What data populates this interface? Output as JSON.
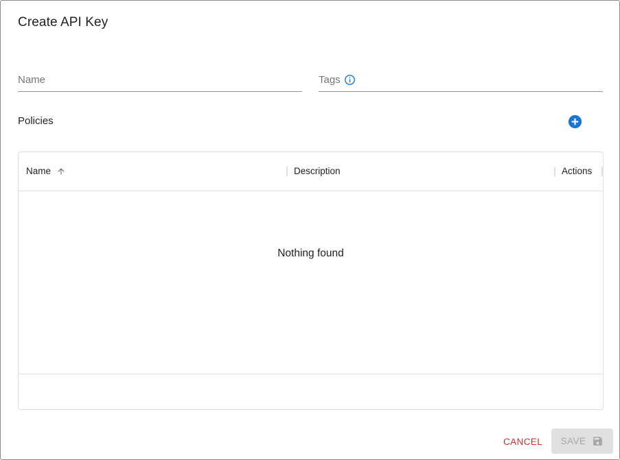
{
  "dialog": {
    "title": "Create API Key"
  },
  "form": {
    "name_label": "Name",
    "name_value": "",
    "tags_label": "Tags",
    "tags_value": "",
    "tags_info_icon": "info-circle-outline-icon"
  },
  "policies": {
    "label": "Policies",
    "add_icon": "add-circle-icon",
    "table": {
      "columns": [
        {
          "label": "Name",
          "sort": "ascending",
          "sort_icon": "arrow-up-icon"
        },
        {
          "label": "Description"
        },
        {
          "label": "Actions"
        }
      ],
      "rows": [],
      "empty_message": "Nothing found"
    }
  },
  "actions": {
    "cancel_label": "CANCEL",
    "save_label": "SAVE",
    "save_icon": "floppy-disk-icon",
    "save_enabled": false
  },
  "colors": {
    "accent": "#1976d2",
    "cancel": "#d32f2f",
    "disabled_bg": "#e0e0e0",
    "disabled_text": "#a6a6a6"
  }
}
